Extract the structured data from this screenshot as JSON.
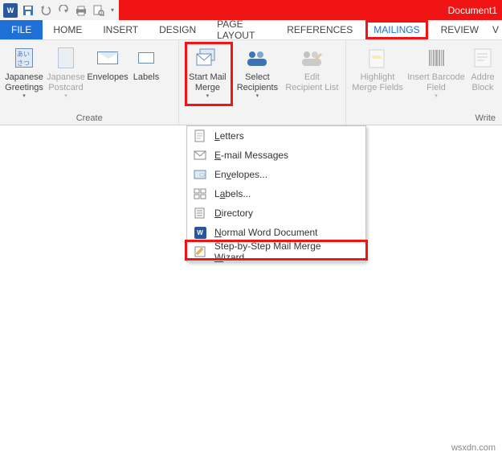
{
  "titlebar": {
    "doc_title": "Document1"
  },
  "tabs": {
    "file": "FILE",
    "items": [
      "HOME",
      "INSERT",
      "DESIGN",
      "PAGE LAYOUT",
      "REFERENCES",
      "MAILINGS",
      "REVIEW",
      "V"
    ],
    "active_index": 5
  },
  "ribbon": {
    "group_create": {
      "label": "Create",
      "japanese_greetings": "Japanese\nGreetings",
      "japanese_postcard": "Japanese\nPostcard",
      "envelopes": "Envelopes",
      "labels": "Labels"
    },
    "start_mail_merge": "Start Mail\nMerge",
    "select_recipients": "Select\nRecipients",
    "edit_recipient_list": "Edit\nRecipient List",
    "highlight_merge_fields": "Highlight\nMerge Fields",
    "insert_barcode_field": "Insert Barcode\nField",
    "address_block": "Addre\nBlock",
    "group_write": {
      "label": "Write"
    }
  },
  "menu": {
    "letters": "Letters",
    "email": "E-mail Messages",
    "envelopes": "Envelopes...",
    "labels": "Labels...",
    "directory": "Directory",
    "normal": "Normal Word Document",
    "wizard": "Step-by-Step Mail Merge Wizard..."
  },
  "watermark": "wsxdn.com"
}
